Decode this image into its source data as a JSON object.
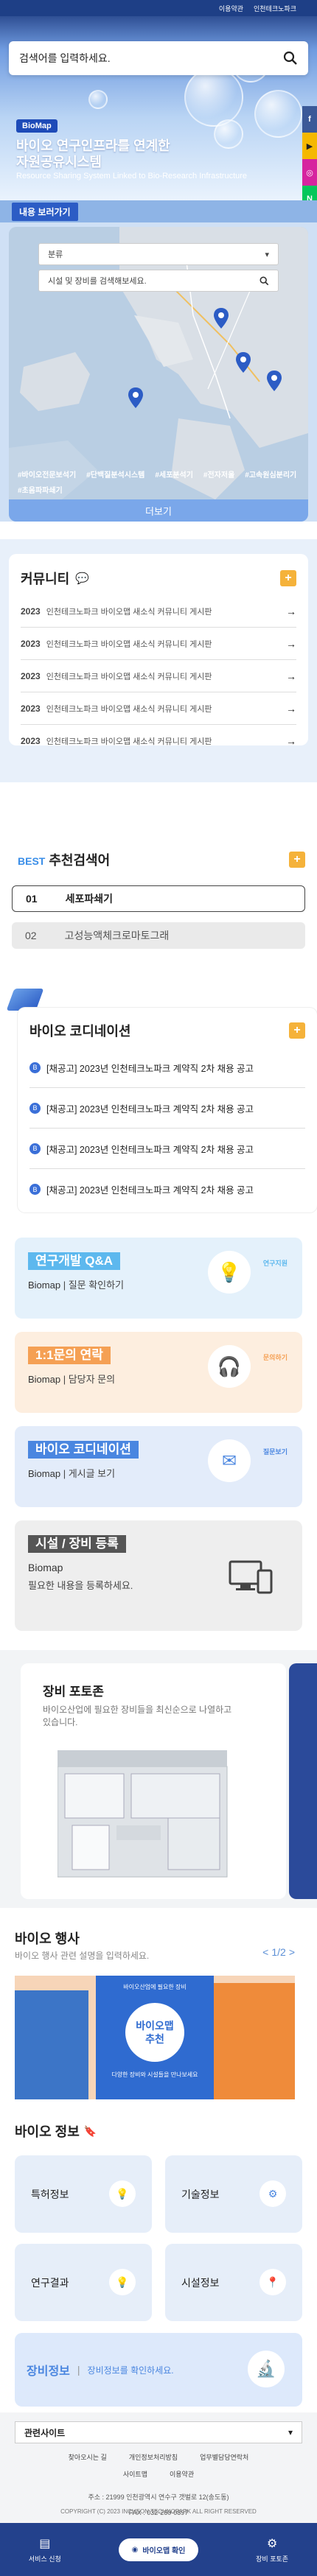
{
  "topbar": {
    "links": [
      "이용약관",
      "인천테크노파크"
    ]
  },
  "search": {
    "placeholder": "검색어를 입력하세요."
  },
  "hero": {
    "badge": "BioMap",
    "title_line1": "바이오 연구인프라를 연계한",
    "title_line2": "자원공유시스템",
    "subtitle": "Resource Sharing System Linked to Bio-Research Infrastructure"
  },
  "sns": [
    "f",
    "▶",
    "◎",
    "N",
    "G"
  ],
  "viewbar": {
    "label": "내용 보러가기"
  },
  "map": {
    "category_select": "분류",
    "search_placeholder": "시설 및 장비를 검색해보세요.",
    "chips": [
      "#바이오전문보석기",
      "#단백질분석시스템",
      "#세포분석기",
      "#전자저울",
      "#고속원심분리기",
      "#초음파파쇄기"
    ],
    "more": "더보기"
  },
  "community": {
    "title": "커뮤니티",
    "rows": [
      {
        "year": "2023",
        "text": "인천테크노파크 바이오맵 새소식 커뮤니티 게시판"
      },
      {
        "year": "2023",
        "text": "인천테크노파크 바이오맵 새소식 커뮤니티 게시판"
      },
      {
        "year": "2023",
        "text": "인천테크노파크 바이오맵 새소식 커뮤니티 게시판"
      },
      {
        "year": "2023",
        "text": "인천테크노파크 바이오맵 새소식 커뮤니티 게시판"
      },
      {
        "year": "2023",
        "text": "인천테크노파크 바이오맵 새소식 커뮤니티 게시판"
      }
    ]
  },
  "best": {
    "prefix": "BEST",
    "title": "추천검색어",
    "items": [
      {
        "num": "01",
        "text": "세포파쇄기"
      },
      {
        "num": "02",
        "text": "고성능액체크로마토그래"
      }
    ]
  },
  "coordinator": {
    "title": "바이오 코디네이션",
    "rows": [
      "[채공고] 2023년 인천테크노파크 계약직 2차 채용 공고",
      "[채공고] 2023년 인천테크노파크 계약직 2차 채용 공고",
      "[채공고] 2023년 인천테크노파크 계약직 2차 채용 공고",
      "[채공고] 2023년 인천테크노파크 계약직 2차 채용 공고"
    ]
  },
  "panels": [
    {
      "tag": "연구개발 Q&A",
      "brand": "Biomap",
      "desc": "질문 확인하기",
      "bubble": "연구지원"
    },
    {
      "tag": "1:1문의 연락",
      "brand": "Biomap",
      "desc": "담당자 문의",
      "bubble": "문의하기"
    },
    {
      "tag": "바이오 코디네이션",
      "brand": "Biomap",
      "desc": "게시글 보기",
      "bubble": "질문보기"
    }
  ],
  "facility": {
    "tag": "시설 / 장비 등록",
    "brand": "Biomap",
    "desc": "필요한 내용을 등록하세요."
  },
  "equipment": {
    "title": "장비 포토존",
    "desc": "바이오산업에 필요한 장비들을 최신순으로 나열하고 있습니다."
  },
  "events": {
    "title": "바이오 행사",
    "desc": "바이오 행사 관련 설명을 입력하세요.",
    "pager": "1/2",
    "banner_small": "바이오산업에 필요한 장비",
    "banner_title1": "바이오맵",
    "banner_title2": "추천",
    "banner_sub": "다양한 장비와 시설들을 만나보세요"
  },
  "bioinfo": {
    "title": "바이오 정보",
    "tiles": [
      "특허정보",
      "기술정보",
      "연구결과",
      "시설정보"
    ],
    "wide_tag": "장비정보",
    "wide_desc": "장비정보를 확인하세요."
  },
  "footer": {
    "related": "관련사이트",
    "links1": [
      "찾아오시는 길",
      "개인정보처리방침",
      "업무별담당연락처"
    ],
    "links2": [
      "사이트맵",
      "이용약관"
    ],
    "address": "주소 : 21999 인천광역시 연수구 갯벌로 12(송도동)",
    "fax": "FAX : 032-260-0897",
    "copyright": "COPYRIGHT (C) 2023 INCHEON TECHNOPARK ALL RIGHT RESERVED"
  },
  "bottomnav": {
    "left": "서비스 신청",
    "center": "바이오맵 확인",
    "right": "장비 포토존"
  },
  "colors": {
    "navy": "#23418c",
    "accent": "#f5b23a",
    "blue": "#2c5cc5"
  }
}
